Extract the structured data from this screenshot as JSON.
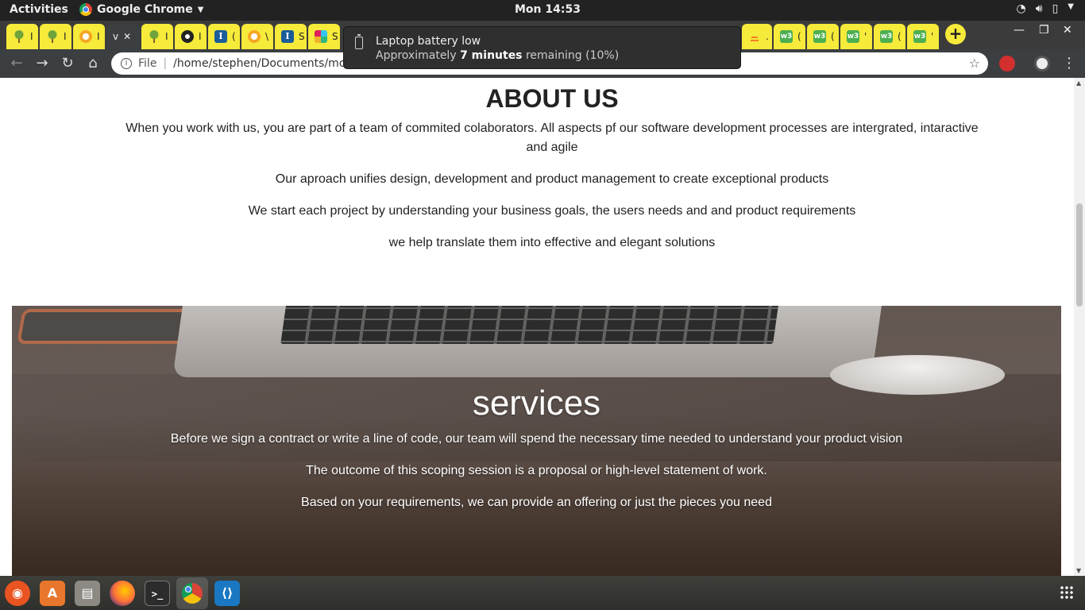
{
  "system_bar": {
    "activities": "Activities",
    "app_name": "Google Chrome",
    "clock": "Mon 14:53"
  },
  "browser": {
    "tabs": [
      {
        "favicon": "tree-icon",
        "label": "I"
      },
      {
        "favicon": "tree-icon",
        "label": "I"
      },
      {
        "favicon": "globe-icon",
        "label": "I"
      },
      {
        "favicon": "",
        "label": "v",
        "active": true
      },
      {
        "favicon": "tree-icon",
        "label": "I"
      },
      {
        "favicon": "github-icon",
        "label": "I"
      },
      {
        "favicon": "ib-icon",
        "label": "("
      },
      {
        "favicon": "globe-icon",
        "label": "\\"
      },
      {
        "favicon": "ib-icon",
        "label": "S"
      },
      {
        "favicon": "slack-icon",
        "label": "S"
      },
      {
        "favicon": "stackoverflow-icon",
        "label": "."
      },
      {
        "favicon": "w3-icon",
        "label": "("
      },
      {
        "favicon": "w3-icon",
        "label": "("
      },
      {
        "favicon": "w3-icon",
        "label": "'"
      },
      {
        "favicon": "w3-icon",
        "label": "("
      },
      {
        "favicon": "w3-icon",
        "label": "'"
      }
    ],
    "tab_close": "✕",
    "new_tab": "+",
    "address_scheme": "File",
    "address_url": "/home/stephen/Documents/morin"
  },
  "notification": {
    "title": "Laptop battery low",
    "body_prefix": "Approximately ",
    "body_bold": "7 minutes",
    "body_suffix": " remaining (10%)"
  },
  "about": {
    "heading": "ABOUT US",
    "paragraphs": [
      "When you work with us, you are part of a team of commited colaborators. All aspects pf our software development processes are intergrated, intaractive and agile",
      "Our aproach unifies design, development and product management to create exceptional products",
      "We start each project by understanding your business goals, the users needs and and product requirements",
      "we help translate them into effective and elegant solutions"
    ]
  },
  "services": {
    "heading": "services",
    "paragraphs": [
      "Before we sign a contract or write a line of code, our team will spend the necessary time needed to understand your product vision",
      "The outcome of this scoping session is a proposal or high-level statement of work.",
      "Based on your requirements, we can provide an offering or just the pieces you need"
    ]
  },
  "dock": {
    "items": [
      "ubuntu-software",
      "software-updater",
      "files",
      "firefox",
      "terminal",
      "chrome",
      "vscode"
    ]
  }
}
